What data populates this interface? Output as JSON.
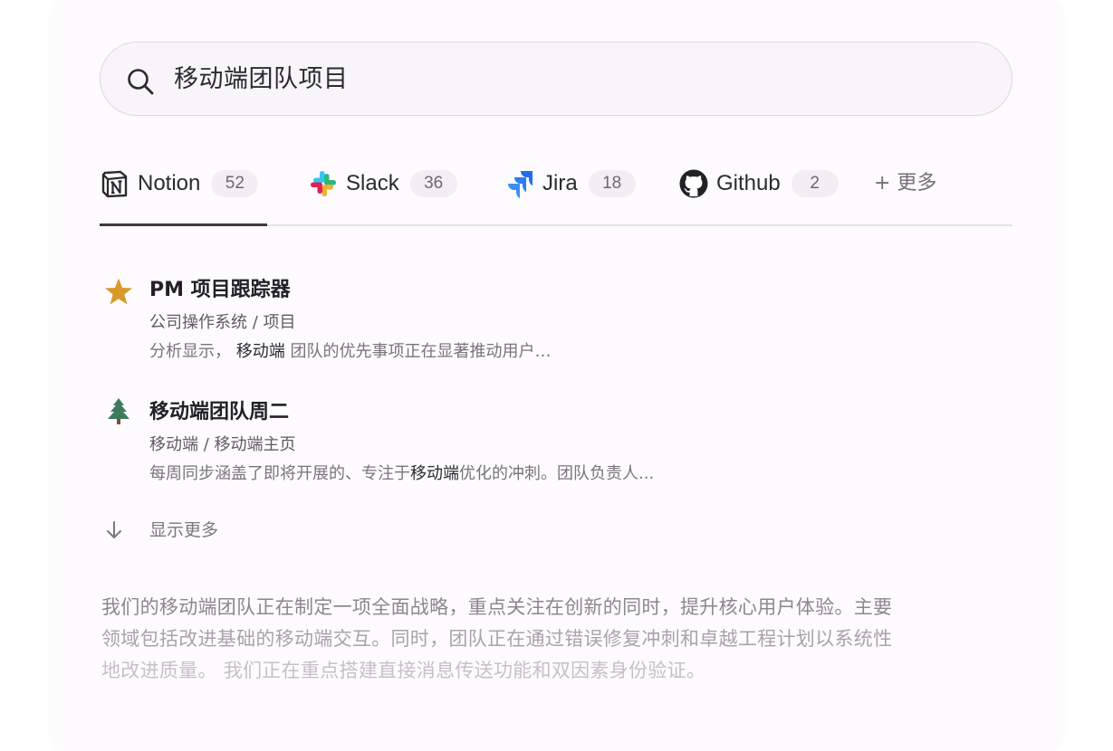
{
  "search": {
    "query": "移动端团队项目"
  },
  "tabs": [
    {
      "label": "Notion",
      "count": "52",
      "icon": "notion-icon"
    },
    {
      "label": "Slack",
      "count": "36",
      "icon": "slack-icon"
    },
    {
      "label": "Jira",
      "count": "18",
      "icon": "jira-icon"
    },
    {
      "label": "Github",
      "count": "2",
      "icon": "github-icon"
    }
  ],
  "more_tab": "+ 更多",
  "active_tab": "Notion",
  "results": [
    {
      "icon": "star-icon",
      "title": "PM 项目跟踪器",
      "path": "公司操作系统 / 项目",
      "snippet_pre": "分析显示，",
      "snippet_highlight": "移动端",
      "snippet_post": "团队的优先事项正在显著推动用户…"
    },
    {
      "icon": "tree-icon",
      "title": "移动端团队周二",
      "path": "移动端 / 移动端主页",
      "snippet_pre": "每周同步涵盖了即将开展的、专注于",
      "snippet_highlight": "移动端",
      "snippet_post": "优化的冲刺。团队负责人..."
    }
  ],
  "show_more": "显示更多",
  "summary": {
    "line1": "我们的移动端团队正在制定一项全面战略，重点关注在创新的同时，提升核心用户体验。主要",
    "line2": "领域包括改进基础的移动端交互。同时，团队正在通过错误修复冲刺和卓越工程计划以系统性",
    "line3": "地改进质量。 我们正在重点搭建直接消息传送功能和双因素身份验证。"
  },
  "colors": {
    "star": "#d99a2b",
    "tree": "#3f7a5e",
    "jira": "#1f6feb",
    "text_primary": "#2b2a2e"
  }
}
